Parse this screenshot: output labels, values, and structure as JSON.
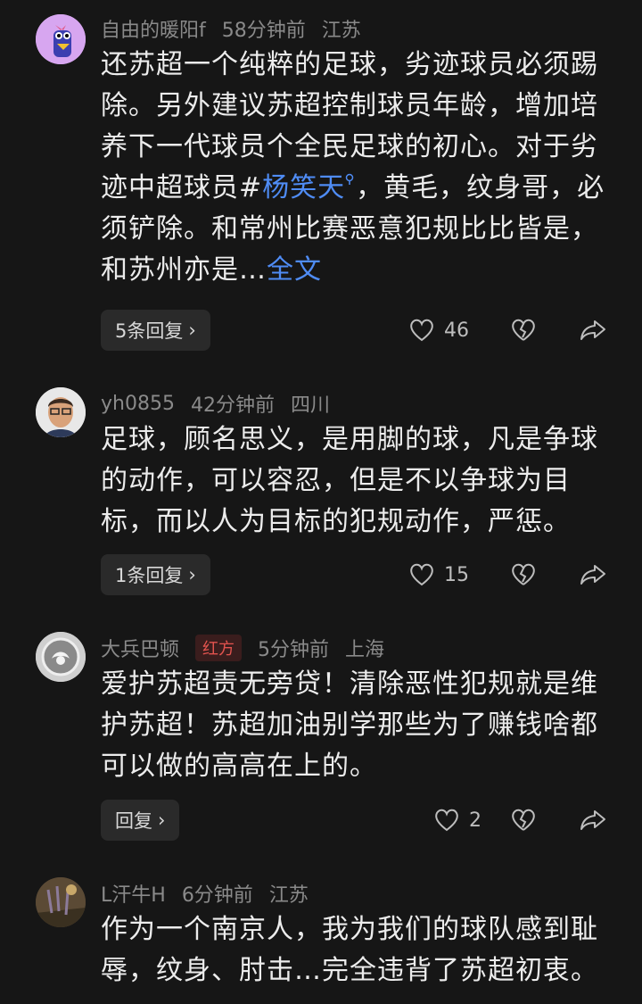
{
  "comments": [
    {
      "user": "自由的暖阳f",
      "time": "58分钟前",
      "location": "江苏",
      "text_before": "还苏超一个纯粹的足球，劣迹球员必须踢除。另外建议苏超控制球员年龄，增加培养下一代球员个全民足球的初心。对于劣迹中超球员#",
      "link": "杨笑天",
      "text_after": "，黄毛，纹身哥，必须铲除。和常州比赛恶意犯规比比皆是，和苏州亦是…",
      "more": "全文",
      "reply_label": "5条回复",
      "likes": "46"
    },
    {
      "user": "yh0855",
      "time": "42分钟前",
      "location": "四川",
      "text": "足球，顾名思义，是用脚的球，凡是争球的动作，可以容忍，但是不以争球为目标，而以人为目标的犯规动作，严惩。",
      "reply_label": "1条回复",
      "likes": "15"
    },
    {
      "user": "大兵巴顿",
      "badge": "红方",
      "time": "5分钟前",
      "location": "上海",
      "text": "爱护苏超责无旁贷！清除恶性犯规就是维护苏超！苏超加油别学那些为了赚钱啥都可以做的高高在上的。",
      "reply_label": "回复",
      "likes": "2"
    },
    {
      "user": "L汗牛H",
      "time": "6分钟前",
      "location": "江苏",
      "text": "作为一个南京人，我为我们的球队感到耻辱，纹身、肘击…完全违背了苏超初衷。"
    }
  ],
  "reply_arrow": "›",
  "colors": {
    "background": "#161616",
    "link": "#4f8cf5",
    "badge": "#e2534e"
  },
  "icons": [
    "heart-icon",
    "broken-heart-icon",
    "share-icon",
    "chevron-right-icon"
  ]
}
